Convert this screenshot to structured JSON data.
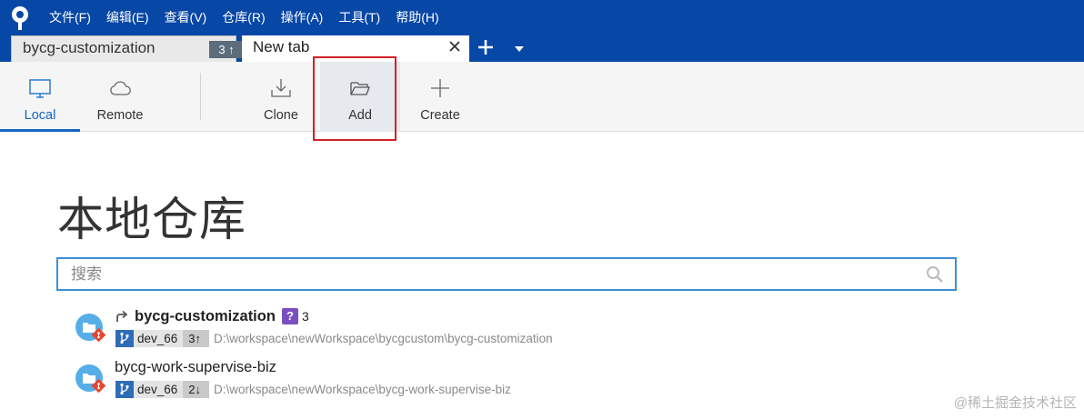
{
  "menu": [
    {
      "label": "文件(F)"
    },
    {
      "label": "编辑(E)"
    },
    {
      "label": "查看(V)"
    },
    {
      "label": "仓库(R)"
    },
    {
      "label": "操作(A)"
    },
    {
      "label": "工具(T)"
    },
    {
      "label": "帮助(H)"
    }
  ],
  "tabs": [
    {
      "label": "bycg-customization",
      "badge": "3 ↑"
    },
    {
      "label": "New tab"
    }
  ],
  "toolbar": {
    "local": "Local",
    "remote": "Remote",
    "clone": "Clone",
    "add": "Add",
    "create": "Create"
  },
  "main": {
    "title": "本地仓库",
    "search_placeholder": "搜索"
  },
  "repos": [
    {
      "name": "bycg-customization",
      "unknown_badge": "?",
      "count": "3",
      "branch": "dev_66",
      "ahead": "3↑",
      "path": "D:\\workspace\\newWorkspace\\bycgcustom\\bycg-customization"
    },
    {
      "name": "bycg-work-supervise-biz",
      "branch": "dev_66",
      "ahead": "2↓",
      "path": "D:\\workspace\\newWorkspace\\bycg-work-supervise-biz"
    }
  ],
  "watermark": "@稀土掘金技术社区",
  "colors": {
    "titlebar": "#0747a6",
    "accent": "#1565c0",
    "highlight": "#d32027",
    "search_border": "#3c8fd6"
  }
}
